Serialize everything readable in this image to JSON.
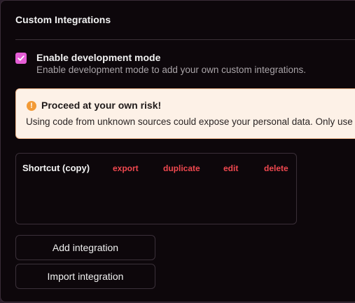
{
  "section": {
    "title": "Custom Integrations"
  },
  "dev_mode": {
    "checked": true,
    "label": "Enable development mode",
    "description": "Enable development mode to add your own custom integrations."
  },
  "warning": {
    "title": "Proceed at your own risk!",
    "text": "Using code from unknown sources could expose your personal data. Only use integrations you trust.",
    "icon": "!"
  },
  "integration": {
    "name": "Shortcut (copy)",
    "actions": {
      "export": "export",
      "duplicate": "duplicate",
      "edit": "edit",
      "delete": "delete"
    }
  },
  "buttons": {
    "add": "Add integration",
    "import": "Import integration"
  },
  "colors": {
    "accent": "#e55ed6",
    "action_red": "#f0484f",
    "warning_bg": "#fdf1e7",
    "warning_border": "#f0b58c",
    "warning_icon": "#f29a36"
  }
}
